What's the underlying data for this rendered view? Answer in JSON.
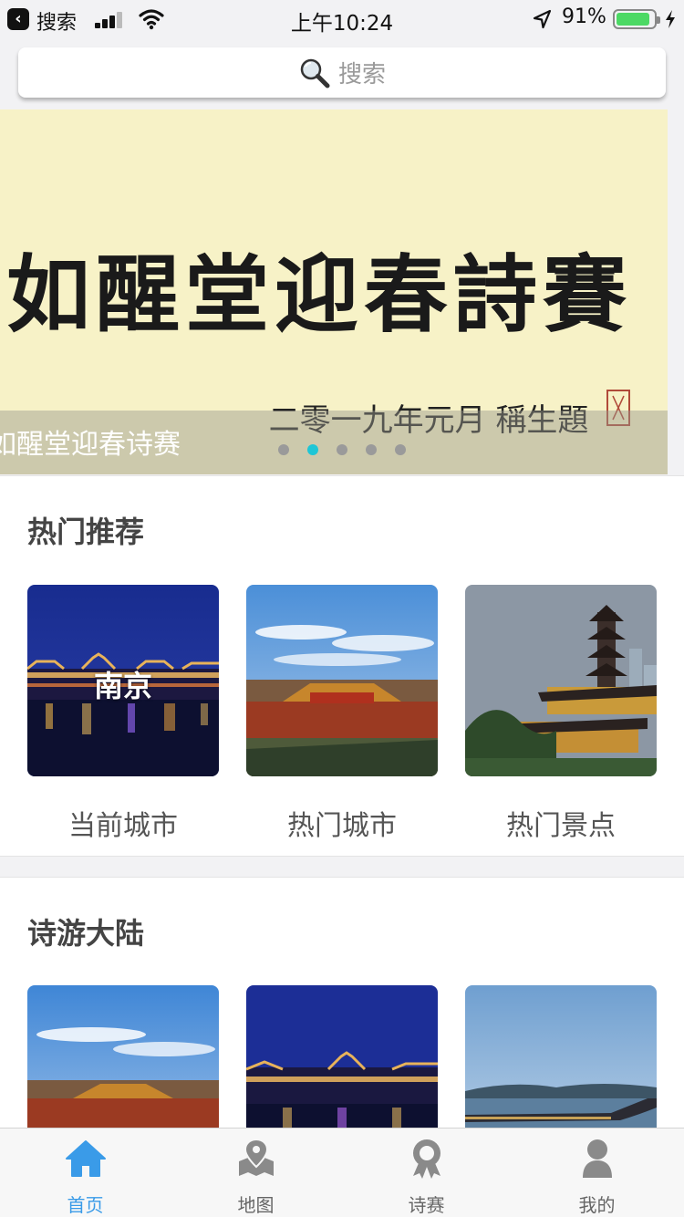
{
  "status_bar": {
    "back_label": "搜索",
    "time": "上午10:24",
    "battery_percent": "91%",
    "battery_level": 0.91
  },
  "search": {
    "placeholder": "搜索",
    "icon": "magnifier-icon"
  },
  "banner": {
    "calligraphy": "如醒堂迎春詩賽",
    "inscription": "二零一九年元月 稱生題",
    "caption": "如醒堂迎春诗赛",
    "slide_count": 5,
    "active_slide": 1,
    "colors": {
      "background": "#f7f2c7",
      "active_dot": "#1ec6d6"
    }
  },
  "hot": {
    "title": "热门推荐",
    "cards": [
      {
        "overlay": "南京",
        "label": "当前城市",
        "image": "nanjing-night-river"
      },
      {
        "overlay": "",
        "label": "热门城市",
        "image": "forbidden-city"
      },
      {
        "overlay": "",
        "label": "热门景点",
        "image": "pagoda-temple"
      }
    ]
  },
  "shiyou": {
    "title": "诗游大陆",
    "cards": [
      {
        "image": "forbidden-city"
      },
      {
        "image": "nanjing-night-river"
      },
      {
        "image": "lake-bridge"
      }
    ]
  },
  "tabbar": {
    "active_color": "#3a9be8",
    "items": [
      {
        "label": "首页",
        "icon": "home-icon",
        "active": true
      },
      {
        "label": "地图",
        "icon": "map-pin-icon",
        "active": false
      },
      {
        "label": "诗赛",
        "icon": "award-icon",
        "active": false
      },
      {
        "label": "我的",
        "icon": "user-icon",
        "active": false
      }
    ]
  }
}
